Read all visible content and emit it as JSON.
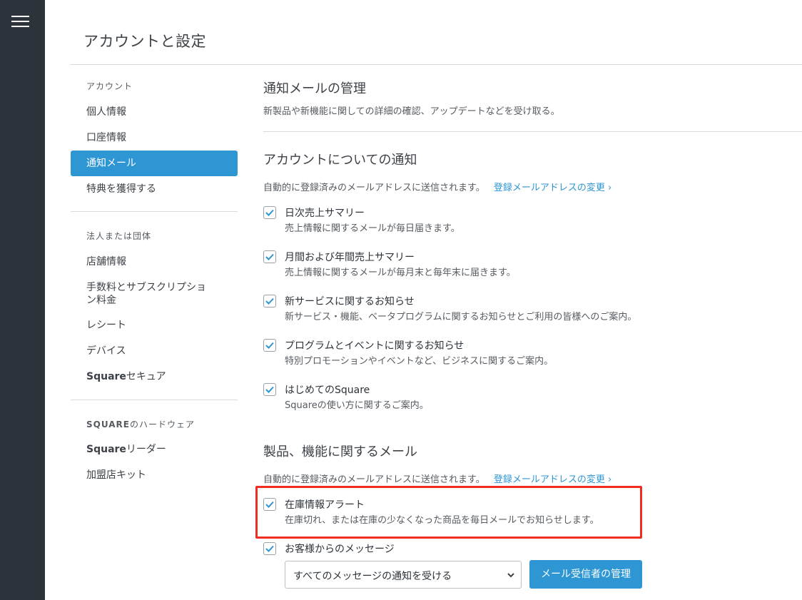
{
  "page_title": "アカウントと設定",
  "sidebar": {
    "section_account": "アカウント",
    "items_account": [
      {
        "label": "個人情報"
      },
      {
        "label": "口座情報"
      },
      {
        "label": "通知メール"
      },
      {
        "label": "特典を獲得する"
      }
    ],
    "section_business": "法人または団体",
    "items_business": [
      {
        "label": "店舗情報"
      },
      {
        "label": "手数料とサブスクリプション料金"
      },
      {
        "label": "レシート"
      },
      {
        "label": "デバイス"
      },
      {
        "brand": "Square",
        "label": "セキュア"
      }
    ],
    "section_hardware_brand": "SQUARE",
    "section_hardware_rest": "のハードウェア",
    "items_hardware": [
      {
        "brand": "Square",
        "label": "リーダー"
      },
      {
        "label": "加盟店キット"
      }
    ]
  },
  "main": {
    "title": "通知メールの管理",
    "subtitle": "新製品や新機能に関しての詳細の確認、アップデートなどを受け取る。",
    "account_section": {
      "title": "アカウントについての通知",
      "desc": "自動的に登録済みのメールアドレスに送信されます。",
      "link": "登録メールアドレスの変更 ›",
      "items": [
        {
          "label": "日次売上サマリー",
          "sub": "売上情報に関するメールが毎日届きます。",
          "checked": true
        },
        {
          "label": "月間および年間売上サマリー",
          "sub": "売上情報に関するメールが毎月末と毎年末に届きます。",
          "checked": true
        },
        {
          "label": "新サービスに関するお知らせ",
          "sub": "新サービス・機能、ベータプログラムに関するお知らせとご利用の皆様へのご案内。",
          "checked": true
        },
        {
          "label": "プログラムとイベントに関するお知らせ",
          "sub": "特別プロモーションやイベントなど、ビジネスに関するご案内。",
          "checked": true
        },
        {
          "label": "はじめてのSquare",
          "sub": "Squareの使い方に関するご案内。",
          "checked": true
        }
      ]
    },
    "product_section": {
      "title": "製品、機能に関するメール",
      "desc": "自動的に登録済みのメールアドレスに送信されます。",
      "link": "登録メールアドレスの変更 ›",
      "items": [
        {
          "label": "在庫情報アラート",
          "sub": "在庫切れ、または在庫の少なくなった商品を毎日メールでお知らせします。",
          "checked": true
        },
        {
          "label": "お客様からのメッセージ",
          "checked": true
        }
      ],
      "select_value": "すべてのメッセージの通知を受ける",
      "manage_button": "メール受信者の管理"
    }
  },
  "colors": {
    "accent": "#2d96d3",
    "rail": "#2c333a",
    "highlight": "#f02d21"
  },
  "icons": {
    "menu": "hamburger-icon",
    "check": "checkmark-icon",
    "chevron": "chevron-down-icon"
  }
}
